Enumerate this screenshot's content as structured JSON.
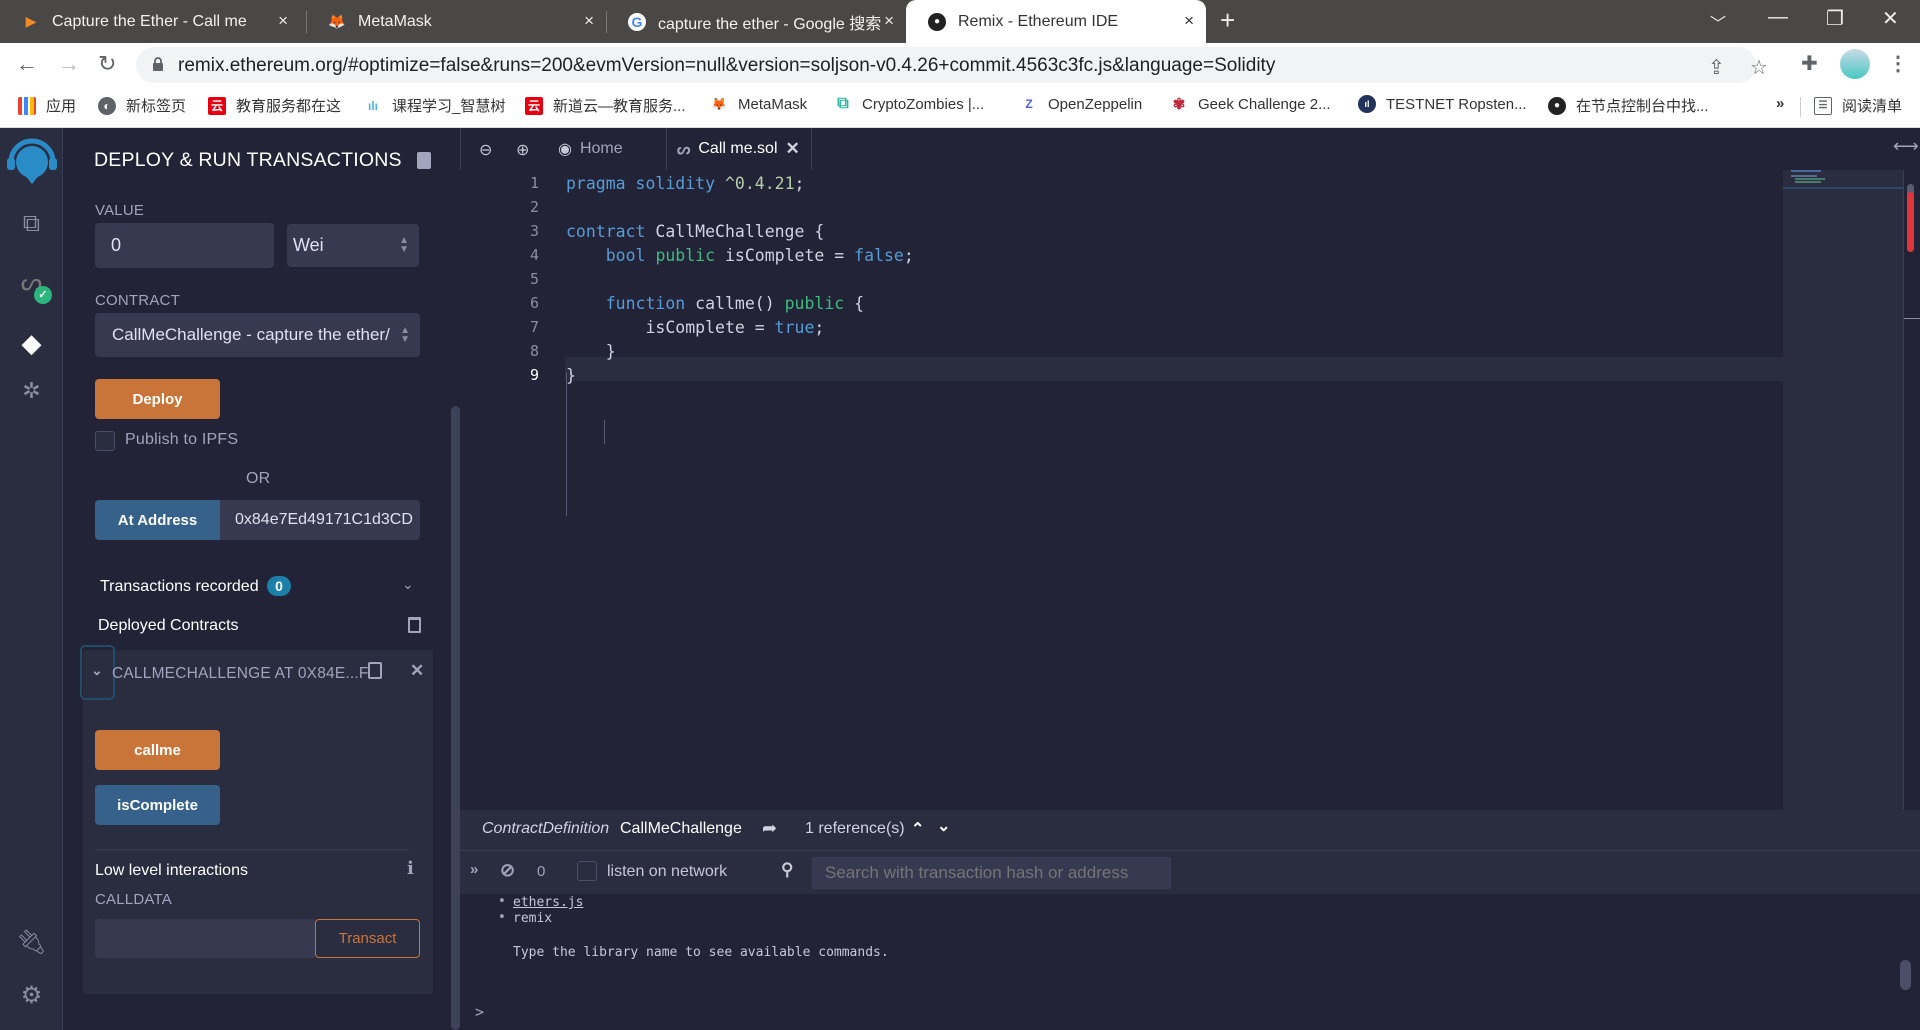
{
  "browser": {
    "tabs": [
      {
        "title": "Capture the Ether - Call me",
        "icon": "play-triangle-icon",
        "active": false
      },
      {
        "title": "MetaMask",
        "icon": "metamask-fox-icon",
        "active": false
      },
      {
        "title": "capture the ether - Google 搜索",
        "icon": "google-g-icon",
        "active": false
      },
      {
        "title": "Remix - Ethereum IDE",
        "icon": "remix-logo-icon",
        "active": true
      }
    ],
    "close_glyph": "×",
    "new_tab_glyph": "+",
    "url": "remix.ethereum.org/#optimize=false&runs=200&evmVersion=null&version=soljson-v0.4.26+commit.4563c3fc.js&language=Solidity",
    "bookmarks": [
      {
        "label": "应用",
        "icon": "apps-grid-icon"
      },
      {
        "label": "新标签页",
        "icon": "globe-icon"
      },
      {
        "label": "教育服务都在这",
        "icon": "yun-red-icon"
      },
      {
        "label": "课程学习_智慧树",
        "icon": "bars-chart-icon"
      },
      {
        "label": "新道云—教育服务...",
        "icon": "yun-red-icon"
      },
      {
        "label": "MetaMask",
        "icon": "metamask-fox-icon"
      },
      {
        "label": "CryptoZombies |...",
        "icon": "cryptozombies-icon"
      },
      {
        "label": "OpenZeppelin",
        "icon": "openzeppelin-icon"
      },
      {
        "label": "Geek Challenge 2...",
        "icon": "flower-icon"
      },
      {
        "label": "TESTNET Ropsten...",
        "icon": "etherscan-icon"
      },
      {
        "label": "在节点控制台中找...",
        "icon": "github-icon"
      }
    ],
    "bookmarks_overflow": "»",
    "reading_list": "阅读清单"
  },
  "side_panel": {
    "title": "DEPLOY & RUN TRANSACTIONS",
    "value_label": "VALUE",
    "value": "0",
    "unit": "Wei",
    "contract_label": "CONTRACT",
    "contract": "CallMeChallenge - capture the ether/",
    "deploy_label": "Deploy",
    "publish_ipfs_label": "Publish to IPFS",
    "publish_ipfs_checked": false,
    "or_label": "OR",
    "at_address_label": "At Address",
    "at_address_value": "0x84e7Ed49171C1d3CD",
    "transactions_recorded_label": "Transactions recorded",
    "transactions_recorded_count": "0",
    "deployed_contracts_label": "Deployed Contracts",
    "deployed_instance": {
      "title": "CALLMECHALLENGE AT 0X84E...F",
      "functions": [
        {
          "label": "callme",
          "kind": "transact",
          "color": "#c97539"
        },
        {
          "label": "isComplete",
          "kind": "call",
          "color": "#35618a"
        }
      ]
    },
    "low_level_label": "Low level interactions",
    "calldata_label": "CALLDATA",
    "calldata_value": "",
    "transact_label": "Transact"
  },
  "editor": {
    "tabs": [
      {
        "label": "Home",
        "icon": "remix-logo-icon",
        "active": false
      },
      {
        "label": "Call me.sol",
        "icon": "solidity-icon",
        "active": true
      }
    ],
    "close_glyph": "✕",
    "active_line": 9,
    "lines": [
      {
        "n": "1"
      },
      {
        "n": "2"
      },
      {
        "n": "3"
      },
      {
        "n": "4"
      },
      {
        "n": "5"
      },
      {
        "n": "6"
      },
      {
        "n": "7"
      },
      {
        "n": "8"
      },
      {
        "n": "9"
      }
    ],
    "code": {
      "l1": {
        "a": "pragma",
        "b": "solidity",
        "c": "^0.4.21",
        "d": ";"
      },
      "l3": {
        "a": "contract",
        "b": "CallMeChallenge {"
      },
      "l4": {
        "a": "bool",
        "b": "public",
        "c": "isComplete =",
        "d": "false",
        "e": ";"
      },
      "l6": {
        "a": "function",
        "b": "callme()",
        "c": "public",
        "d": "{"
      },
      "l7": {
        "a": "isComplete =",
        "b": "true",
        "c": ";"
      },
      "l8": {
        "a": "}"
      },
      "l9": {
        "a": "}"
      }
    }
  },
  "reference_bar": {
    "kind": "ContractDefinition",
    "name": "CallMeChallenge",
    "references": "1 reference(s)"
  },
  "terminal": {
    "pending_count": "0",
    "listen_label": "listen on network",
    "listen_checked": false,
    "search_placeholder": "Search with transaction hash or address",
    "output": [
      {
        "text": "ethers.js",
        "link": true
      },
      {
        "text": "remix",
        "link": false
      }
    ],
    "hint": "Type the library name to see available commands.",
    "prompt": ">"
  },
  "colors": {
    "accent_orange": "#c97539",
    "accent_blue": "#35618a",
    "badge": "#1b7fa8",
    "panel_bg": "#222336",
    "panel_bg_light": "#2a2c3f"
  }
}
